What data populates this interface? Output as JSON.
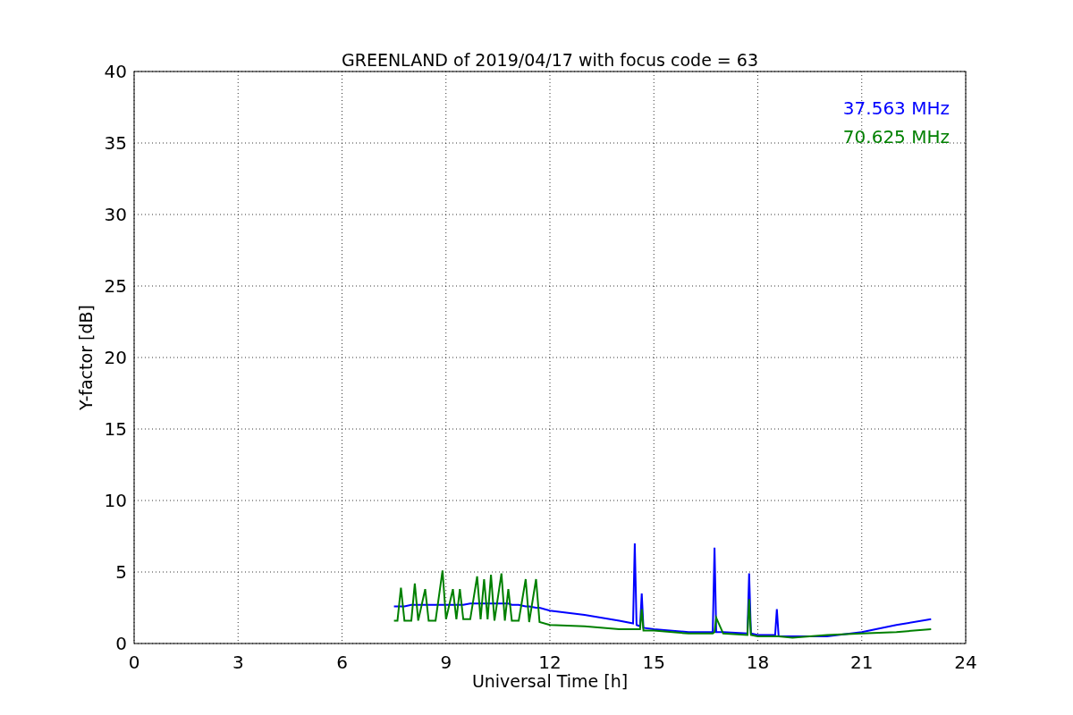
{
  "chart_data": {
    "type": "line",
    "title": "GREENLAND of 2019/04/17 with focus code = 63",
    "xlabel": "Universal Time [h]",
    "ylabel": "Y-factor [dB]",
    "x": [
      7.5,
      7.6,
      7.7,
      7.8,
      8.0,
      8.1,
      8.2,
      8.4,
      8.5,
      8.7,
      8.9,
      9.0,
      9.2,
      9.3,
      9.4,
      9.5,
      9.7,
      9.9,
      10.0,
      10.1,
      10.2,
      10.3,
      10.4,
      10.6,
      10.7,
      10.8,
      10.9,
      11.1,
      11.3,
      11.4,
      11.6,
      11.7,
      12,
      13,
      14,
      14.4,
      14.45,
      14.5,
      14.6,
      14.65,
      14.7,
      15,
      16,
      16.7,
      16.75,
      16.8,
      17,
      17.7,
      17.75,
      17.8,
      18,
      18.5,
      18.55,
      18.6,
      19,
      20,
      21,
      22,
      23
    ],
    "series": [
      {
        "name": "37.563 MHz",
        "color": "#0000ff",
        "values": [
          2.6,
          2.6,
          2.6,
          2.6,
          2.7,
          2.7,
          2.7,
          2.7,
          2.7,
          2.7,
          2.7,
          2.7,
          2.7,
          2.7,
          2.7,
          2.7,
          2.8,
          2.8,
          2.8,
          2.8,
          2.8,
          2.8,
          2.8,
          2.8,
          2.8,
          2.8,
          2.7,
          2.7,
          2.6,
          2.6,
          2.5,
          2.5,
          2.3,
          2.0,
          1.6,
          1.4,
          7.0,
          1.3,
          1.2,
          3.5,
          1.1,
          1.0,
          0.8,
          0.8,
          6.7,
          0.8,
          0.8,
          0.7,
          4.9,
          0.7,
          0.6,
          0.6,
          2.4,
          0.5,
          0.5,
          0.5,
          0.8,
          1.3,
          1.7
        ]
      },
      {
        "name": "70.625 MHz",
        "color": "#008000",
        "values": [
          1.6,
          1.6,
          3.9,
          1.6,
          1.6,
          4.2,
          1.6,
          3.8,
          1.6,
          1.6,
          5.1,
          1.7,
          3.8,
          1.7,
          3.8,
          1.7,
          1.7,
          4.7,
          1.7,
          4.5,
          1.7,
          4.8,
          1.6,
          4.9,
          1.6,
          3.8,
          1.6,
          1.6,
          4.5,
          1.5,
          4.5,
          1.5,
          1.3,
          1.2,
          1.0,
          1.0,
          1.0,
          1.0,
          1.0,
          2.4,
          0.9,
          0.9,
          0.7,
          0.7,
          0.8,
          1.8,
          0.7,
          0.6,
          3.1,
          0.6,
          0.5,
          0.5,
          0.5,
          0.5,
          0.4,
          0.6,
          0.7,
          0.8,
          1.0
        ]
      }
    ],
    "grid": true,
    "xlim": [
      0,
      24
    ],
    "ylim": [
      0,
      40
    ],
    "xticks": [
      0,
      3,
      6,
      9,
      12,
      15,
      18,
      21,
      24
    ],
    "yticks": [
      0,
      5,
      10,
      15,
      20,
      25,
      30,
      35,
      40
    ]
  }
}
